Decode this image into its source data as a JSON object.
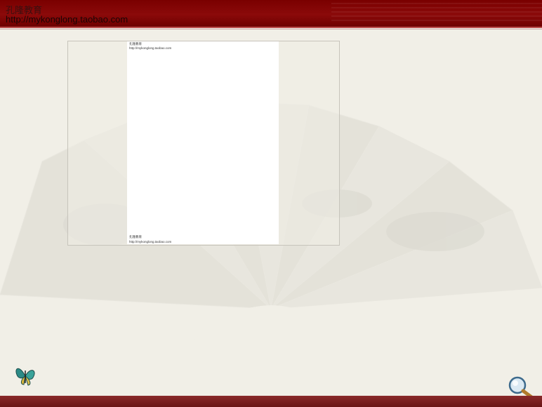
{
  "header": {
    "brand_title": "孔隆教育",
    "brand_url": "http://mykonglong.taobao.com"
  },
  "document": {
    "header_title": "孔隆教育",
    "header_url": "http://mykonglong.taobao.com",
    "footer_title": "孔隆教育",
    "footer_url": "http://mykonglong.taobao.com"
  },
  "icons": {
    "decoration": "butterfly-icon",
    "zoom": "magnifier-icon"
  },
  "colors": {
    "banner": "#7a0000",
    "background": "#f1efe7",
    "bottom_bar": "#7a1d1d"
  }
}
